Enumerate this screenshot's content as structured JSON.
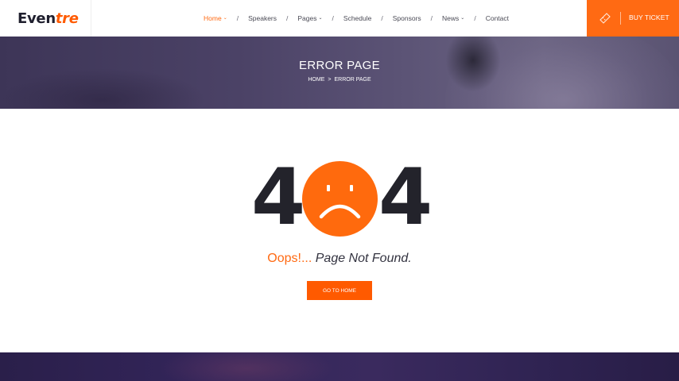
{
  "logo": {
    "main": "Even",
    "accent": "tre"
  },
  "nav": {
    "items": [
      {
        "label": "Home",
        "dropdown": true,
        "active": true
      },
      {
        "label": "Speakers",
        "dropdown": false
      },
      {
        "label": "Pages",
        "dropdown": true
      },
      {
        "label": "Schedule",
        "dropdown": false
      },
      {
        "label": "Sponsors",
        "dropdown": false
      },
      {
        "label": "News",
        "dropdown": true
      },
      {
        "label": "Contact",
        "dropdown": false
      }
    ],
    "separator": "/",
    "chevron": "⌄"
  },
  "buy_ticket": {
    "label": "BUY TICKET",
    "icon": "ticket-icon"
  },
  "banner": {
    "title": "ERROR PAGE",
    "breadcrumb": {
      "home": "HOME",
      "sep": ">",
      "current": "ERROR PAGE"
    }
  },
  "error": {
    "digit_left": "4",
    "digit_right": "4",
    "face_icon": "sad-face-icon",
    "oops": "Oops!...",
    "message": " Page Not Found."
  },
  "go_home": {
    "label": "GO TO HOME"
  },
  "colors": {
    "accent": "#ff6a13",
    "dark": "#23232b",
    "banner": "#4b4266"
  }
}
